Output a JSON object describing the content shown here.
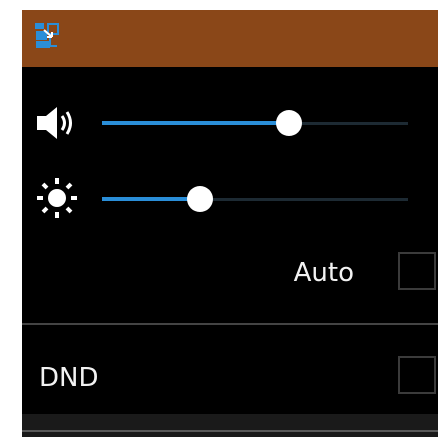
{
  "colors": {
    "title_bar": "#8a4718",
    "background": "#000000",
    "accent": "#2a8ed8",
    "thumb": "#ffffff",
    "track": "#1d2a33",
    "text": "#f2f2f2"
  },
  "header": {
    "icon": "app-swap-icon"
  },
  "volume": {
    "icon": "volume-icon",
    "level_percent": 61
  },
  "brightness": {
    "icon": "brightness-icon",
    "level_percent": 32
  },
  "auto": {
    "label": "Auto",
    "checked": false
  },
  "dnd": {
    "label": "DND",
    "checked": false
  }
}
